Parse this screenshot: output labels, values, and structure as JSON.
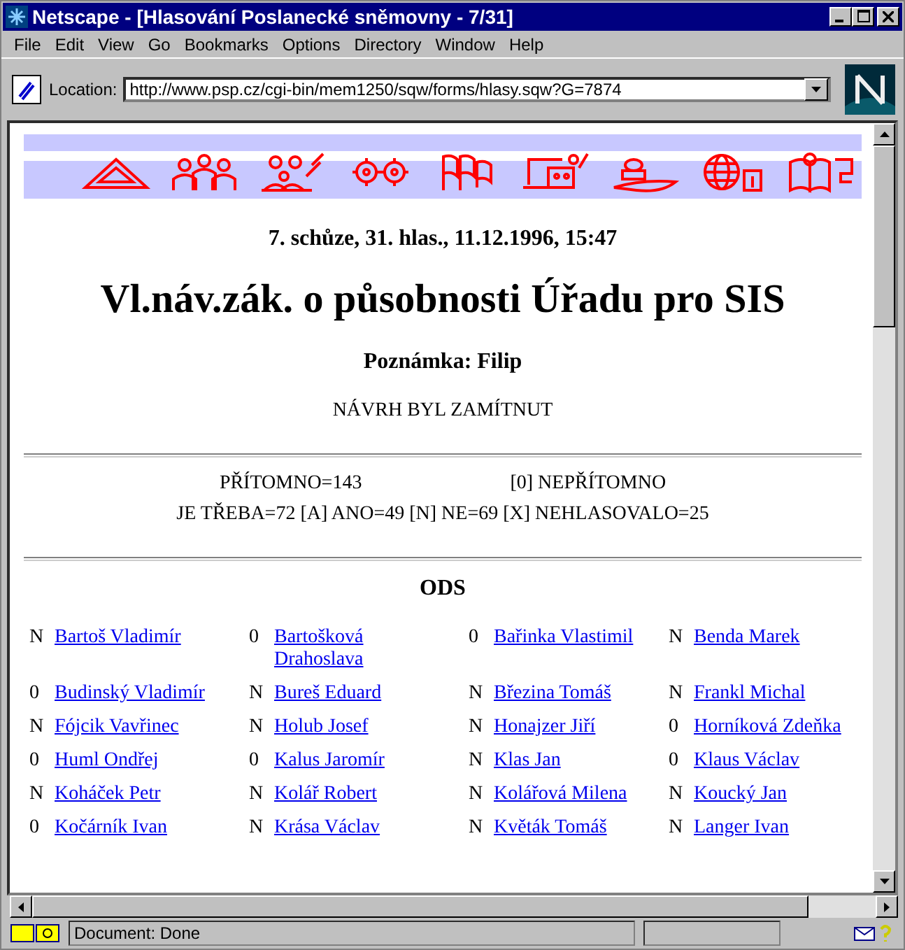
{
  "window": {
    "title": "Netscape - [Hlasování Poslanecké sněmovny - 7/31]"
  },
  "menu": [
    "File",
    "Edit",
    "View",
    "Go",
    "Bookmarks",
    "Options",
    "Directory",
    "Window",
    "Help"
  ],
  "location": {
    "label": "Location:",
    "value": "http://www.psp.cz/cgi-bin/mem1250/sqw/forms/hlasy.sqw?G=7874"
  },
  "page": {
    "session": "7. schůze, 31. hlas., 11.12.1996, 15:47",
    "heading": "Vl.náv.zák. o působnosti Úřadu pro SIS",
    "note": "Poznámka: Filip",
    "result": "NÁVRH BYL ZAMÍTNUT",
    "present": "PŘÍTOMNO=143",
    "absent": "[0] NEPŘÍTOMNO",
    "tally": "JE TŘEBA=72 [A] ANO=49 [N] NE=69 [X] NEHLASOVALO=25",
    "party": "ODS",
    "members": [
      {
        "vote": "N",
        "name": "Bartoš Vladimír"
      },
      {
        "vote": "0",
        "name": "Bartošková Drahoslava"
      },
      {
        "vote": "0",
        "name": "Bařinka Vlastimil"
      },
      {
        "vote": "N",
        "name": "Benda Marek"
      },
      {
        "vote": "0",
        "name": "Budinský Vladimír"
      },
      {
        "vote": "N",
        "name": "Bureš Eduard"
      },
      {
        "vote": "N",
        "name": "Březina Tomáš"
      },
      {
        "vote": "N",
        "name": "Frankl Michal"
      },
      {
        "vote": "N",
        "name": "Fójcik Vavřinec"
      },
      {
        "vote": "N",
        "name": "Holub Josef"
      },
      {
        "vote": "N",
        "name": "Honajzer Jiří"
      },
      {
        "vote": "0",
        "name": "Horníková Zdeňka"
      },
      {
        "vote": "0",
        "name": "Huml Ondřej"
      },
      {
        "vote": "0",
        "name": "Kalus Jaromír"
      },
      {
        "vote": "N",
        "name": "Klas Jan"
      },
      {
        "vote": "0",
        "name": "Klaus Václav"
      },
      {
        "vote": "N",
        "name": "Koháček Petr"
      },
      {
        "vote": "N",
        "name": "Kolář Robert"
      },
      {
        "vote": "N",
        "name": "Kolářová Milena"
      },
      {
        "vote": "N",
        "name": "Koucký Jan"
      },
      {
        "vote": "0",
        "name": "Kočárník Ivan"
      },
      {
        "vote": "N",
        "name": "Krása Václav"
      },
      {
        "vote": "N",
        "name": "Květák Tomáš"
      },
      {
        "vote": "N",
        "name": "Langer Ivan"
      }
    ]
  },
  "status_bar": {
    "text": "Document: Done"
  }
}
